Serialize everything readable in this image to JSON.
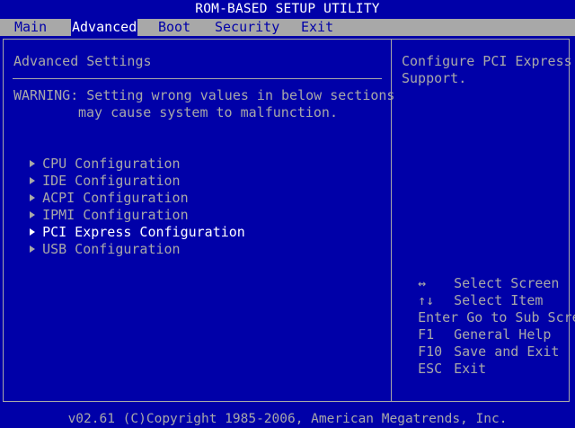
{
  "title": "ROM-BASED SETUP UTILITY",
  "menu": {
    "items": [
      {
        "label": "Main"
      },
      {
        "label": "Advanced"
      },
      {
        "label": "Boot"
      },
      {
        "label": "Security"
      },
      {
        "label": "Exit"
      }
    ],
    "active": "Advanced"
  },
  "left_panel": {
    "heading": "Advanced Settings",
    "warning_line1": "WARNING: Setting wrong values in below sections",
    "warning_line2": "may cause system to malfunction.",
    "submenus": [
      {
        "label": "CPU Configuration",
        "selected": false
      },
      {
        "label": "IDE Configuration",
        "selected": false
      },
      {
        "label": "ACPI Configuration",
        "selected": false
      },
      {
        "label": "IPMI Configuration",
        "selected": false
      },
      {
        "label": "PCI Express Configuration",
        "selected": true
      },
      {
        "label": "USB Configuration",
        "selected": false
      }
    ]
  },
  "help_panel": {
    "line1": "Configure PCI Express",
    "line2": "Support."
  },
  "keys": [
    {
      "key": "↔",
      "action": "Select Screen"
    },
    {
      "key": "↑↓",
      "action": "Select Item"
    },
    {
      "key": "Enter",
      "action": "Go to Sub Screen"
    },
    {
      "key": "F1",
      "action": "General Help"
    },
    {
      "key": "F10",
      "action": "Save and Exit"
    },
    {
      "key": "ESC",
      "action": "Exit"
    }
  ],
  "footer": "v02.61 (C)Copyright 1985-2006, American Megatrends, Inc.",
  "colors": {
    "background": "#0000a8",
    "text": "#a8a8a8",
    "highlight": "#ffffff",
    "menu_bar": "#a8a8a8"
  }
}
